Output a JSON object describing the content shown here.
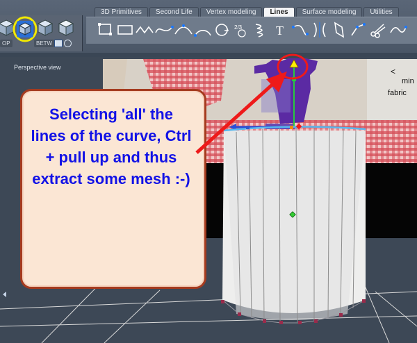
{
  "tabs": [
    "3D Primitives",
    "Second Life",
    "Vertex modeling",
    "Lines",
    "Surface modeling",
    "Utilities"
  ],
  "active_tab": "Lines",
  "left_tools": {
    "btn1": "OP",
    "btn2": "BETW"
  },
  "viewport": {
    "title": "Perspective view"
  },
  "callout": {
    "text": "Selecting 'all' the lines of the curve, Ctrl + pull up and thus extract some mesh :-)"
  },
  "scene_texts": {
    "angle": "<",
    "min": "min",
    "fabric": "fabric"
  },
  "icons": [
    "polyline-tool-icon",
    "rectangle-tool-icon",
    "zigzag-line-icon",
    "spline-icon",
    "bezier-curve-icon",
    "arc-icon",
    "rotate-line-icon",
    "dimension-icon",
    "spring-helix-icon",
    "text-tool-icon",
    "path-icon",
    "mirror-curve-icon",
    "bend-icon",
    "scissors-icon"
  ],
  "colors": {
    "highlight_yellow": "#f3ea00",
    "arrow_red": "#ee1a1a",
    "callout_text": "#1212e6",
    "callout_border": "#a53b1f"
  }
}
